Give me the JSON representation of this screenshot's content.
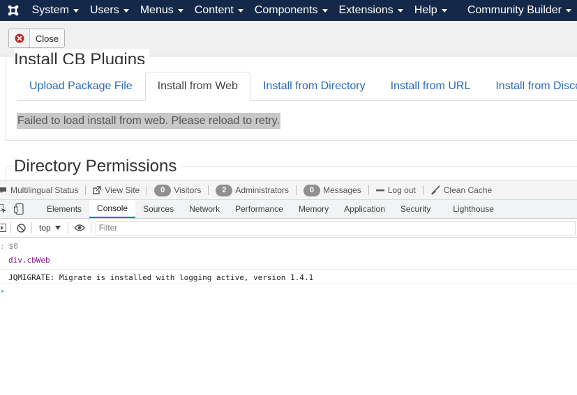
{
  "navbar": {
    "logo_icon": "joomla-logo-icon",
    "items": [
      {
        "label": "System",
        "dropdown": true
      },
      {
        "label": "Users",
        "dropdown": true
      },
      {
        "label": "Menus",
        "dropdown": true
      },
      {
        "label": "Content",
        "dropdown": true
      },
      {
        "label": "Components",
        "dropdown": true
      },
      {
        "label": "Extensions",
        "dropdown": true
      },
      {
        "label": "Help",
        "dropdown": true
      }
    ],
    "right_item": {
      "label": "Community Builder",
      "dropdown": true
    },
    "bg_color": "#142849"
  },
  "toolbar": {
    "close_label": "Close",
    "close_icon": "circle-x-icon",
    "close_icon_color": "#b52a2a"
  },
  "main": {
    "section1_title": "Install CB Plugins",
    "tabs": [
      {
        "label": "Upload Package File",
        "active": false
      },
      {
        "label": "Install from Web",
        "active": true
      },
      {
        "label": "Install from Directory",
        "active": false
      },
      {
        "label": "Install from URL",
        "active": false
      },
      {
        "label": "Install from Disco",
        "active": false
      }
    ],
    "error_message": "Failed to load install from web. Please reload to retry.",
    "section2_title": "Directory Permissions",
    "link_color": "#2a69b8"
  },
  "statusbar": {
    "multilingual": "Multilingual Status",
    "view_site": "View Site",
    "visitors": {
      "count": "0",
      "label": "Visitors"
    },
    "administrators": {
      "count": "2",
      "label": "Administrators"
    },
    "messages": {
      "count": "0",
      "label": "Messages"
    },
    "logout": "Log out",
    "clean_cache": "Clean Cache"
  },
  "devtools": {
    "tabs": [
      {
        "label": "Elements",
        "active": false
      },
      {
        "label": "Console",
        "active": true
      },
      {
        "label": "Sources",
        "active": false
      },
      {
        "label": "Network",
        "active": false
      },
      {
        "label": "Performance",
        "active": false
      },
      {
        "label": "Memory",
        "active": false
      },
      {
        "label": "Application",
        "active": false
      },
      {
        "label": "Security",
        "active": false
      },
      {
        "label": "Lighthouse",
        "active": false
      }
    ],
    "context": "top",
    "filter_placeholder": "Filter",
    "accent_color": "#1a73e8"
  },
  "console": {
    "prompt_symbol": ":",
    "prompt_input": "$0",
    "result": "div.cbWeb",
    "log_message": "JQMIGRATE: Migrate is installed with logging active, version 1.4.1",
    "input_caret": "›"
  }
}
